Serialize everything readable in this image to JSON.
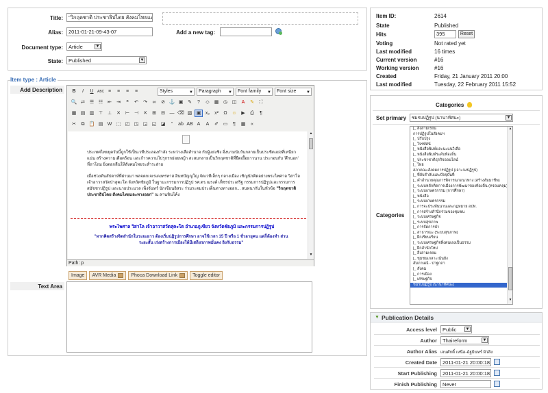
{
  "form": {
    "title_label": "Title:",
    "title_value": "\"วิกฤตชาติ ประชาธิปไตย สังคมไทยและท",
    "alias_label": "Alias:",
    "alias_value": "2011-01-21-09-43-07",
    "doctype_label": "Document type:",
    "doctype_value": "Article",
    "state_label": "State:",
    "state_value": "Published",
    "add_tag_label": "Add a new tag:"
  },
  "meta": [
    {
      "k": "Item ID:",
      "v": "2614"
    },
    {
      "k": "State",
      "v": "Published"
    },
    {
      "k": "Hits",
      "v": "395"
    },
    {
      "k": "Voting",
      "v": "Not rated yet"
    },
    {
      "k": "Last modified",
      "v": "16 times"
    },
    {
      "k": "Current version",
      "v": "#16"
    },
    {
      "k": "Working version",
      "v": "#16"
    },
    {
      "k": "Created",
      "v": "Friday, 21 January 2011 20:00"
    },
    {
      "k": "Last modified",
      "v": "Tuesday, 22 February 2011 15:52"
    }
  ],
  "reset_label": "Reset",
  "item_type": {
    "prefix": "Item type : ",
    "name": "Article",
    "add_description_label": "Add Description",
    "text_area_label": "Text Area"
  },
  "editor": {
    "styles": "Styles",
    "paragraph": "Paragraph",
    "font_family": "Font family",
    "font_size": "Font size",
    "para1": "ประเทศไทยยุควันนี้ถูกใช้เป็นเวทีประลองกำลัง ระหว่างเสือสำนาจ กับผู้แย่งชิง อิ่งนามนับวันกลายเป็นประชิดแย่งที่เหนียวแน่น สร้างความเดือดร้อน และก้าวความไปรุกรกย่อยหญ้า สะสมกลายเป็นวิกฤตชาติที่ยืดเยื้อยาวนาน ประกอบกับ 'ศึกนอก' ที่ถาโถม ยิ่งตอกลืนให้สังคมไทยระส่ำระส่าย",
    "para2_plain": "เมื่อช่วงต้นสัปดาห์ที่ผ่านมา พลจตกเจเรเดงทรทาส อินทปัญญโญ จัดเวทีเล็กๆ กลางเมือง เชิญนักคิดอย่างพระไพศาล วิสาโล เจ้าอาวาสวัดป่าสุคะโต จังหวัดชัยภูมิ ในฐานะกรรมการปฏิรูป รศ.ดร.ณรงค์ เพ็ชรประเสริฐ กรรมการปฏิรูปและกรรมการสมัชชาปฏิรูป และนายประมวล เพ็งจันทร์ นักเขียนอิสระ ร่วมระดมประเด็นทางทางออก... สนทนากันในหัวข้อ",
    "para2_bold": "\"วิกฤตชาติ ประชาธิปไตย สังคมไทยและทางออก\"",
    "para2_tail": " ณ ลานหินโค้ง",
    "heading": "พระไพศาล วิสาโล เจ้าอาวาสวัดสุคะโต อำเภอภูเขียว จังหวัดชัยภูมิ และกรรมการปฏิรูป",
    "quote": "\"หากคิดสร้างจิตสำนักในระยะยาว ต้องเริ่มปฏิรูปการศึกษา อาจใช้เวลา 15 ปี หรือ 1 ชั่วอายุคน แต่ก็ต้องทำ ส่วนระยะสั้น เร่งสร้างการเมืองให้มีเสถียรภาพมั่นคง อิงกับธรรม\"",
    "path": "Path: p"
  },
  "ext_buttons": [
    "Image",
    "AVR Media",
    "Phoca Download Link",
    "Toggle editor"
  ],
  "categories": {
    "title": "Categories",
    "set_primary_label": "Set primary",
    "set_primary_value": "ชมรมปฏิรูป (นานาทัศนะ)",
    "list_label": "Categories",
    "items": [
      "|_ สิ่งสามเรยน",
      "การปฏิรูปในสังคมฯ",
      "|_ ปรับปรุง",
      "|_ ใจรทัศน์",
      "|_ หนังสือพิมพ์และนะแนวิเลือ",
      "|_ หนังสือพิมพ์ระดับท้องถิ่น",
      "|_ ประชาชาติธุรกิจออนไลน์",
      "|_ ไทย",
      "สภาคณะสังคมการปฏิรูป (เจาะจงปฏิรูป)",
      "|_ ที่ลับสำลับและปัจจุบันที่",
      "|_ คำอำนวยคุณการพิจารณาแนวทาง (สร้างสัมมาชีพ)",
      "|_ ระบบหลักคิดการเมืองการพัฒนาของท้องถิ่น (ครอบคลุม)",
      "|_ ระบบเกษตรกรรม (การศึกษา)",
      "|_ หนังสือ",
      "|_ ระบบเกษตรกรรม",
      "|_ การจะประพันนานและกฎหมาย อปท.",
      "|_ การสร้างสำนึกร่วมของชุมชน",
      "|_ ระบบเศรษฐกิจ",
      "|_ ระบบสุขภาพ",
      "|_ การจัดการป่า",
      "|_ สาธารณะ (ระบบสุขภาพ)",
      "|_ ฝีกเรียนเรียน",
      "|_ ระบบเศรษฐกิจพึ่งตนเองเป็นธรรม",
      "|_ ฝึกสำนักใหม่",
      "|_ สิ่งสามเรยน",
      "|_ ชุมชนเกลาะเน้นยัง",
      "สัมภาษณ์ - ปาฐกถา",
      "|_ สังคม",
      "|_ การเมือง",
      "|_ เศรษฐกิจ",
      "ชมรมปฏิรูป (นานาทัศนะ)"
    ]
  },
  "publication": {
    "title": "Publication Details",
    "rows": [
      {
        "k": "Access level",
        "v": "Public"
      },
      {
        "k": "Author",
        "v": "Thaireform"
      },
      {
        "k": "Author Alias",
        "v": "เจนศักดิ์ เหนือ-ฉัฐมินทร์ ผิวสิง"
      },
      {
        "k": "Created Date",
        "v": "2011-01-21 20:00:18"
      },
      {
        "k": "Start Publishing",
        "v": "2011-01-21 20:00:18"
      },
      {
        "k": "Finish Publishing",
        "v": "Never"
      }
    ]
  }
}
